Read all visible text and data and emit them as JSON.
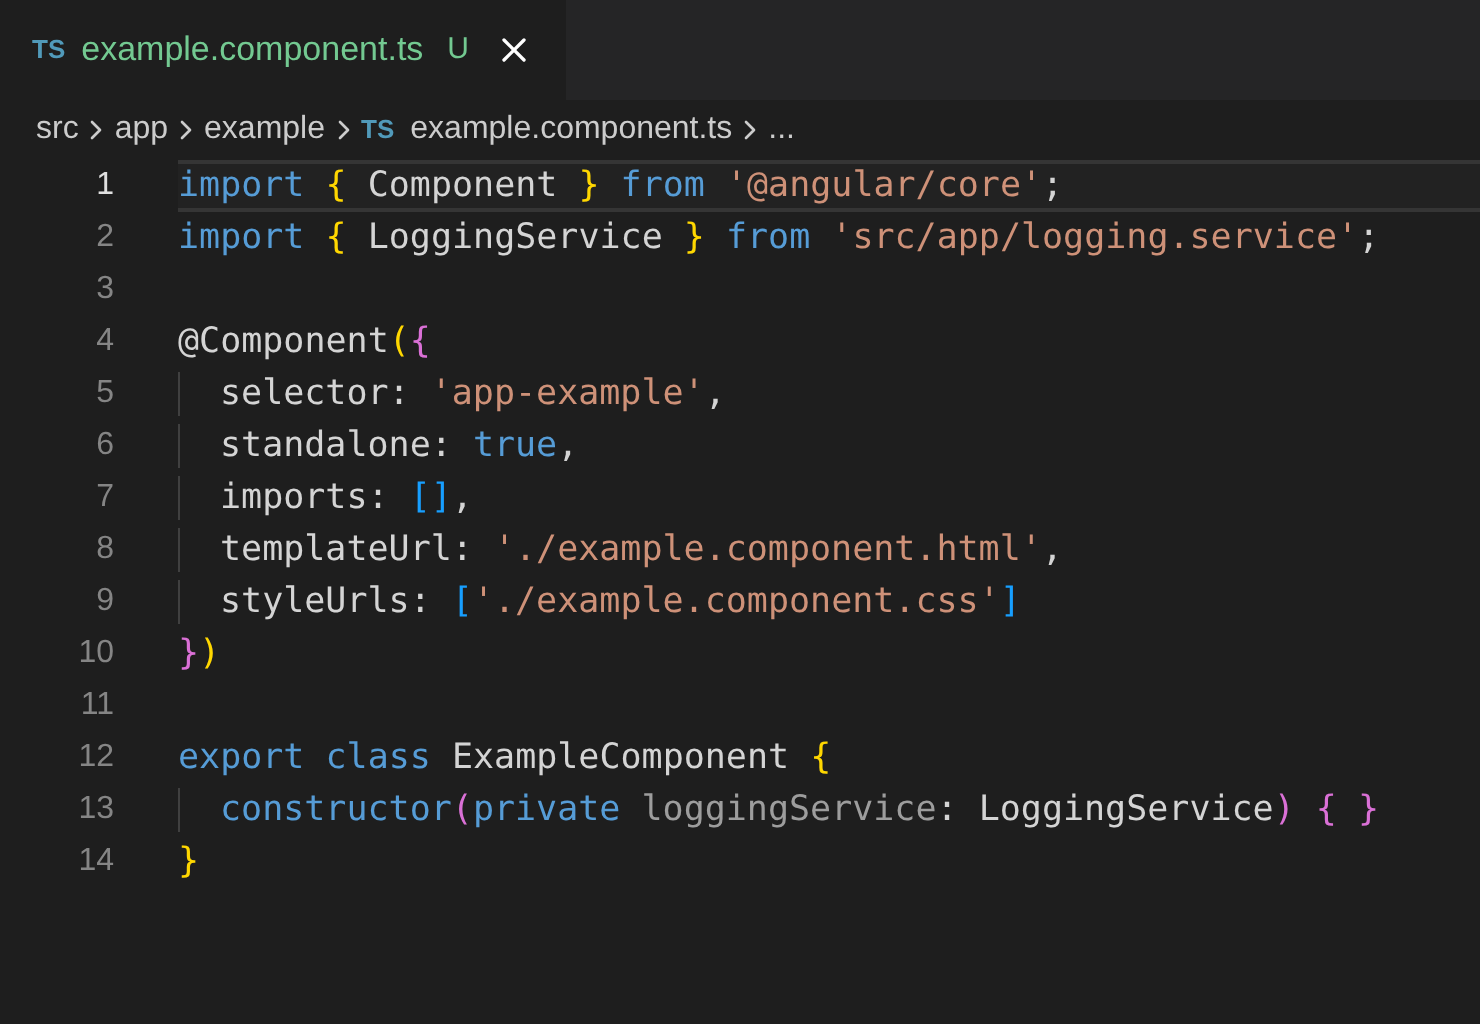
{
  "tab": {
    "lang_badge": "TS",
    "title": "example.component.ts",
    "status": "U",
    "selected": true
  },
  "breadcrumbs": [
    {
      "kind": "folder",
      "label": "src"
    },
    {
      "kind": "folder",
      "label": "app"
    },
    {
      "kind": "folder",
      "label": "example"
    },
    {
      "kind": "file",
      "badge": "TS",
      "label": "example.component.ts"
    },
    {
      "kind": "more",
      "label": "..."
    }
  ],
  "lines": [
    {
      "number": "1",
      "selected": true,
      "indented": false,
      "tokens": [
        {
          "kind": "keyword",
          "text": "import "
        },
        {
          "kind": "brace1",
          "text": "{"
        },
        {
          "kind": "plain",
          "text": " Component "
        },
        {
          "kind": "brace1",
          "text": "}"
        },
        {
          "kind": "keyword",
          "text": " from "
        },
        {
          "kind": "string",
          "text": "'@angular/core'"
        },
        {
          "kind": "plain",
          "text": ";"
        }
      ]
    },
    {
      "number": "2",
      "selected": false,
      "indented": false,
      "tokens": [
        {
          "kind": "keyword",
          "text": "import "
        },
        {
          "kind": "brace1",
          "text": "{"
        },
        {
          "kind": "plain",
          "text": " LoggingService "
        },
        {
          "kind": "brace1",
          "text": "}"
        },
        {
          "kind": "keyword",
          "text": " from "
        },
        {
          "kind": "string",
          "text": "'src/app/logging.service'"
        },
        {
          "kind": "plain",
          "text": ";"
        }
      ]
    },
    {
      "number": "3",
      "selected": false,
      "indented": false
    },
    {
      "number": "4",
      "selected": false,
      "indented": false,
      "tokens": [
        {
          "kind": "plain",
          "text": "@Component"
        },
        {
          "kind": "brace1",
          "text": "("
        },
        {
          "kind": "brace2",
          "text": "{"
        }
      ]
    },
    {
      "number": "5",
      "selected": false,
      "indented": true,
      "tokens": [
        {
          "kind": "plain",
          "text": "selector: "
        },
        {
          "kind": "string",
          "text": "'app-example'"
        },
        {
          "kind": "plain",
          "text": ","
        }
      ]
    },
    {
      "number": "6",
      "selected": false,
      "indented": true,
      "tokens": [
        {
          "kind": "plain",
          "text": "standalone: "
        },
        {
          "kind": "keyword",
          "text": "true"
        },
        {
          "kind": "plain",
          "text": ","
        }
      ]
    },
    {
      "number": "7",
      "selected": false,
      "indented": true,
      "tokens": [
        {
          "kind": "plain",
          "text": "imports: "
        },
        {
          "kind": "brace3",
          "text": "[]"
        },
        {
          "kind": "plain",
          "text": ","
        }
      ]
    },
    {
      "number": "8",
      "selected": false,
      "indented": true,
      "tokens": [
        {
          "kind": "plain",
          "text": "templateUrl: "
        },
        {
          "kind": "string",
          "text": "'./example.component.html'"
        },
        {
          "kind": "plain",
          "text": ","
        }
      ]
    },
    {
      "number": "9",
      "selected": false,
      "indented": true,
      "tokens": [
        {
          "kind": "plain",
          "text": "styleUrls: "
        },
        {
          "kind": "brace3",
          "text": "["
        },
        {
          "kind": "string",
          "text": "'./example.component.css'"
        },
        {
          "kind": "brace3",
          "text": "]"
        }
      ]
    },
    {
      "number": "10",
      "selected": false,
      "indented": false,
      "tokens": [
        {
          "kind": "brace2",
          "text": "}"
        },
        {
          "kind": "brace1",
          "text": ")"
        }
      ]
    },
    {
      "number": "11",
      "selected": false,
      "indented": false
    },
    {
      "number": "12",
      "selected": false,
      "indented": false,
      "tokens": [
        {
          "kind": "keyword",
          "text": "export class "
        },
        {
          "kind": "plain",
          "text": "ExampleComponent "
        },
        {
          "kind": "brace1",
          "text": "{"
        }
      ]
    },
    {
      "number": "13",
      "selected": false,
      "indented": true,
      "tokens": [
        {
          "kind": "keyword",
          "text": "constructor"
        },
        {
          "kind": "brace2",
          "text": "("
        },
        {
          "kind": "keyword",
          "text": "private "
        },
        {
          "kind": "unused",
          "text": "loggingService"
        },
        {
          "kind": "plain",
          "text": ": LoggingService"
        },
        {
          "kind": "brace2",
          "text": ")"
        },
        {
          "kind": "brace2",
          "text": " { }"
        }
      ]
    },
    {
      "number": "14",
      "selected": false,
      "indented": false,
      "tokens": [
        {
          "kind": "brace1",
          "text": "}"
        }
      ]
    }
  ]
}
